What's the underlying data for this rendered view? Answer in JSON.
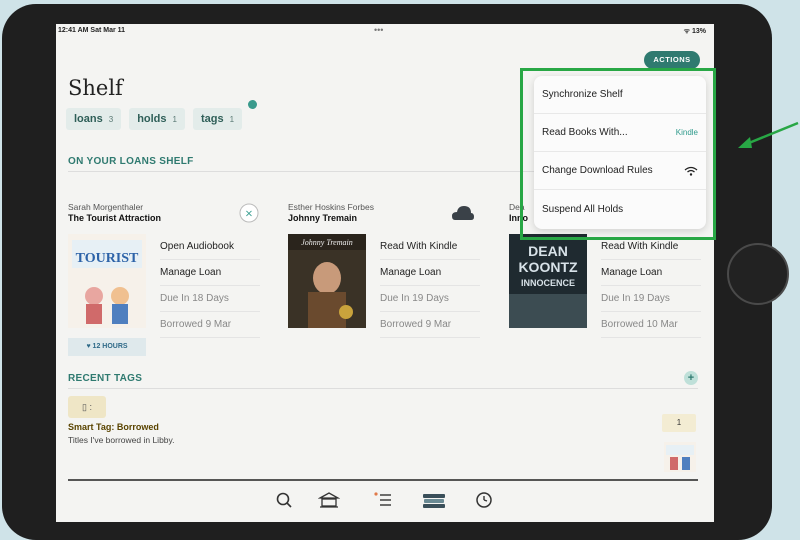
{
  "status": {
    "time": "12:41 AM  Sat Mar 11",
    "dots": "•••",
    "battery": "13%"
  },
  "header": {
    "actions_label": "ACTIONS",
    "title": "Shelf"
  },
  "chips": [
    {
      "label": "loans",
      "count": "3"
    },
    {
      "label": "holds",
      "count": "1"
    },
    {
      "label": "tags",
      "count": "1"
    }
  ],
  "loans_section": {
    "header": "ON YOUR LOANS SHELF"
  },
  "books": [
    {
      "author": "Sarah Morgenthaler",
      "title": "The Tourist Attraction",
      "options": [
        "Open Audiobook",
        "Manage Loan",
        "Due In 18 Days",
        "Borrowed 9 Mar"
      ],
      "badge": "12 HOURS",
      "cover_text": "TOURIST"
    },
    {
      "author": "Esther Hoskins Forbes",
      "title": "Johnny Tremain",
      "options": [
        "Read With Kindle",
        "Manage Loan",
        "Due In 19 Days",
        "Borrowed 9 Mar"
      ],
      "cover_text": "Johnny Tremain"
    },
    {
      "author": "Dea",
      "title": "Inno",
      "options": [
        "Read With Kindle",
        "Manage Loan",
        "Due In 19 Days",
        "Borrowed 10 Mar"
      ],
      "cover_text": "DEAN KOONTZ INNOCENCE"
    }
  ],
  "actions_menu": {
    "items": [
      {
        "label": "Synchronize Shelf",
        "hint": ""
      },
      {
        "label": "Read Books With...",
        "hint": "Kindle"
      },
      {
        "label": "Change Download Rules",
        "hint": ""
      },
      {
        "label": "Suspend All Holds",
        "hint": ""
      }
    ]
  },
  "recent_tags": {
    "header": "RECENT TAGS",
    "smart_title": "Smart Tag: Borrowed",
    "smart_sub": "Titles I've borrowed in Libby.",
    "count": "1",
    "tag_icon": "▯ :"
  },
  "colors": {
    "accent": "#2f7a70",
    "highlight_box": "#28a745"
  }
}
